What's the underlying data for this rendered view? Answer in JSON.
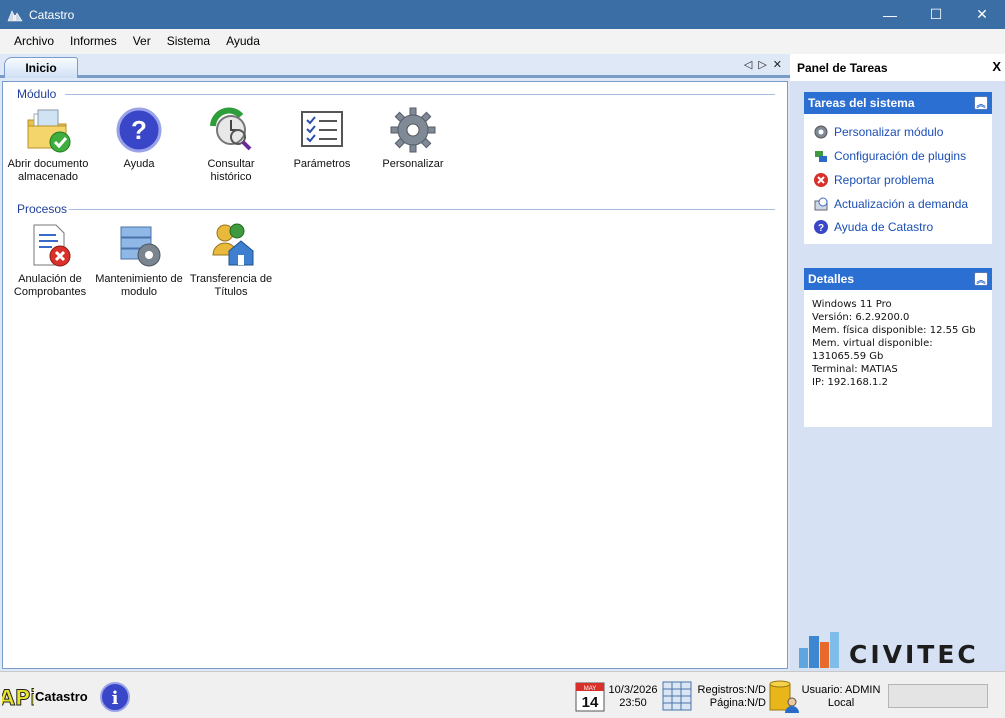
{
  "window": {
    "title": "Catastro",
    "minimize": "—",
    "maximize": "☐",
    "close": "✕"
  },
  "menu": [
    "Archivo",
    "Informes",
    "Ver",
    "Sistema",
    "Ayuda"
  ],
  "tabs": {
    "active": "Inicio"
  },
  "tab_controls": {
    "prev": "◁",
    "next": "▷",
    "close": "✕"
  },
  "sections": {
    "modulo": {
      "title": "Módulo",
      "items": [
        {
          "label": "Abrir documento almacenado",
          "icon": "folder-check-icon"
        },
        {
          "label": "Ayuda",
          "icon": "help-icon"
        },
        {
          "label": "Consultar histórico",
          "icon": "history-icon"
        },
        {
          "label": "Parámetros",
          "icon": "checklist-icon"
        },
        {
          "label": "Personalizar",
          "icon": "gear-icon"
        }
      ]
    },
    "procesos": {
      "title": "Procesos",
      "items": [
        {
          "label": "Anulación de Comprobantes",
          "icon": "cancel-document-icon"
        },
        {
          "label": "Mantenimiento de modulo",
          "icon": "maintenance-icon"
        },
        {
          "label": "Transferencia de Títulos",
          "icon": "transfer-house-icon"
        }
      ]
    }
  },
  "task_panel": {
    "title": "Panel de Tareas",
    "close": "X",
    "system_tasks": {
      "title": "Tareas del sistema",
      "items": [
        {
          "label": "Personalizar módulo",
          "icon": "gear-icon"
        },
        {
          "label": "Configuración de plugins",
          "icon": "plugin-icon"
        },
        {
          "label": "Reportar problema",
          "icon": "error-icon"
        },
        {
          "label": "Actualización a demanda",
          "icon": "update-icon"
        },
        {
          "label": "Ayuda de Catastro",
          "icon": "help-icon"
        }
      ]
    },
    "details": {
      "title": "Detalles",
      "lines": [
        "Windows 11 Pro",
        "Versión: 6.2.9200.0",
        "Mem. física disponible: 12.55 Gb",
        "Mem. virtual disponible:",
        "131065.59 Gb",
        "Terminal: MATIAS",
        "IP: 192.168.1.2"
      ]
    },
    "logo_text": "CIVITEC"
  },
  "statusbar": {
    "logo_text": "APi",
    "app_name": "Catastro",
    "calendar_month": "MAY",
    "calendar_day": "14",
    "date": "10/3/2026",
    "time": "23:50",
    "registros": "Registros:N/D",
    "pagina": "Página:N/D",
    "usuario": "Usuario: ADMIN",
    "ubicacion": "Local"
  },
  "colors": {
    "titlebar": "#3b6ea5",
    "group_header": "#2c6fd2",
    "link": "#1c4fb5",
    "section_title": "#1f3f99"
  }
}
